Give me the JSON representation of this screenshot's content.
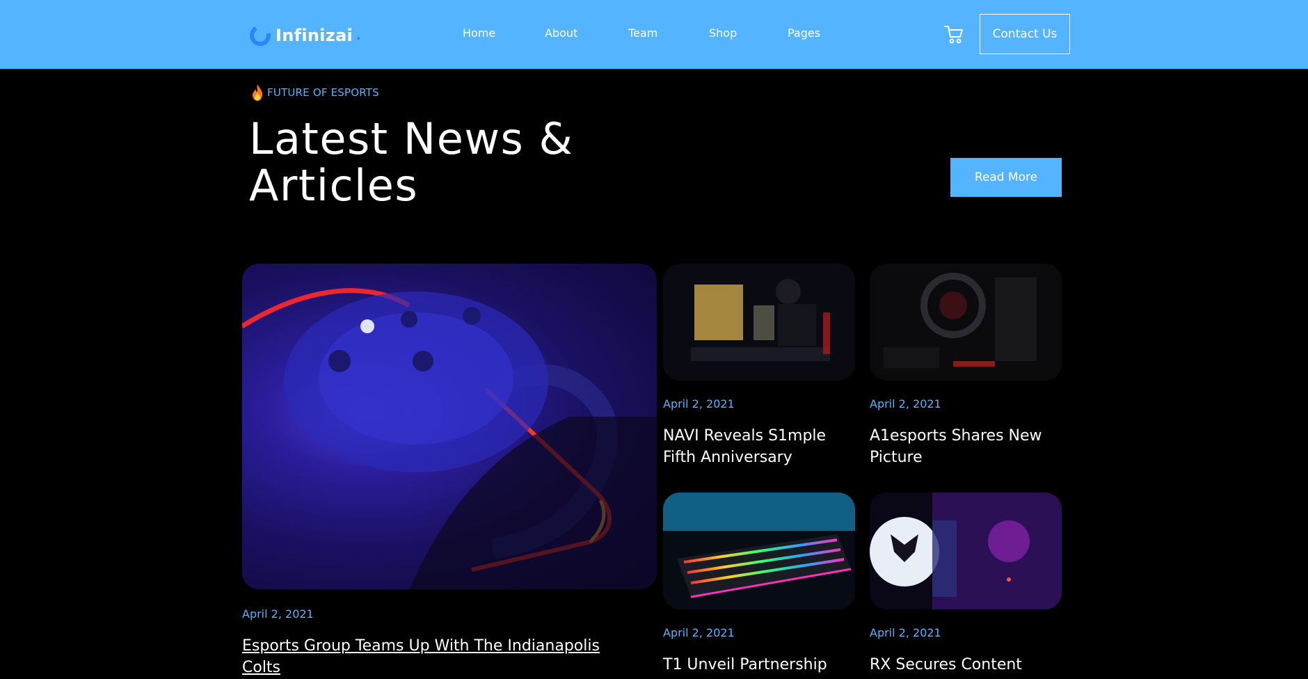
{
  "header": {
    "logo_text": "Infinizai",
    "nav": [
      {
        "label": "Home"
      },
      {
        "label": "About"
      },
      {
        "label": "Team"
      },
      {
        "label": "Shop"
      },
      {
        "label": "Pages"
      }
    ],
    "contact_label": "Contact Us",
    "cart_icon": "cart-icon"
  },
  "hero": {
    "eyebrow_icon": "fire-icon",
    "eyebrow": "FUTURE OF ESPORTS",
    "headline_line1": "Latest News &",
    "headline_line2": "Articles",
    "read_more_label": "Read More"
  },
  "articles": [
    {
      "date": "April 2, 2021",
      "title_line1": "Esports Group Teams Up With The Indianapolis",
      "title_line2": "Colts"
    },
    {
      "date": "April 2, 2021",
      "title_line1": "NAVI Reveals S1mple",
      "title_line2": "Fifth Anniversary"
    },
    {
      "date": "April 2, 2021",
      "title_line1": "A1esports Shares New",
      "title_line2": "Picture"
    },
    {
      "date": "April 2, 2021",
      "title_line1": "T1 Unveil Partnership",
      "title_line2": ""
    },
    {
      "date": "April 2, 2021",
      "title_line1": "RX Secures Content",
      "title_line2": ""
    }
  ],
  "colors": {
    "accent": "#55b4ff",
    "background": "#000000"
  }
}
